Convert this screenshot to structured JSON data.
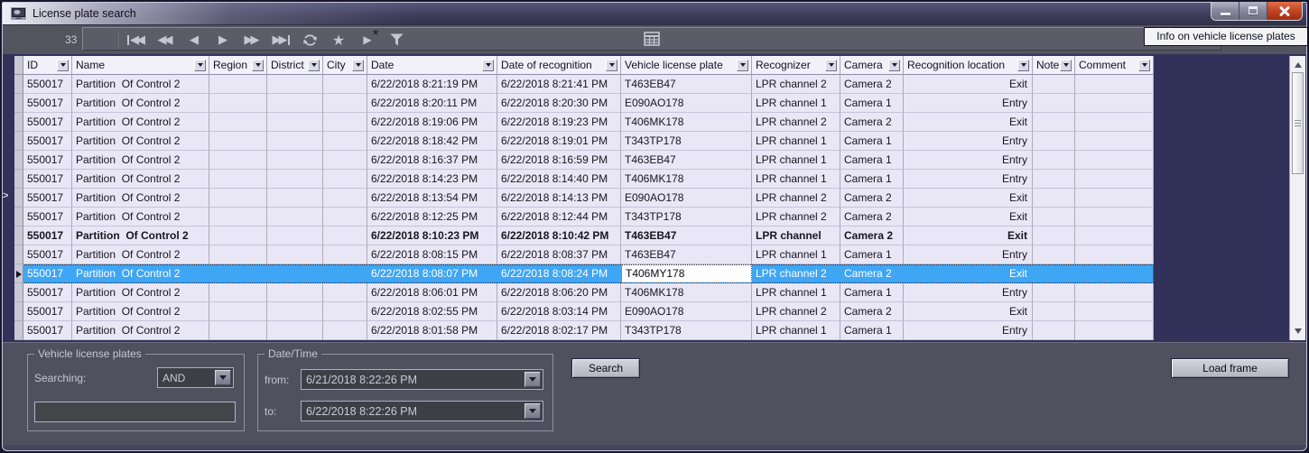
{
  "window": {
    "title": "License plate search"
  },
  "toolbar": {
    "record_count": "33",
    "nav_glyphs": {
      "first": "◀◀",
      "rewind": "◀◀",
      "previous": "◀",
      "next": "▶",
      "forward": "▶▶",
      "last": "▶▶",
      "star": "★",
      "go_to_star": "▶",
      "go_to_star_badge": "★"
    }
  },
  "info_button_label": "Info on vehicle license plates",
  "icons": {
    "app-icon": "framed picture",
    "grid-view-icon": "table grid",
    "refresh-icon": "circular arrows",
    "star-icon": "star",
    "go-to-star-icon": "play triangle with star",
    "filter-icon": "funnel",
    "minimize-icon": "bar",
    "maximize-icon": "box",
    "close-icon": "x cross",
    "filter-dropdown-icon": "down triangle",
    "scroll-arrows": "up/down triangles",
    "collapse-arrow": ">"
  },
  "table": {
    "columns": [
      {
        "key": "id",
        "label": "ID",
        "width": 54
      },
      {
        "key": "name",
        "label": "Name",
        "width": 152
      },
      {
        "key": "region",
        "label": "Region",
        "width": 64
      },
      {
        "key": "district",
        "label": "District",
        "width": 62
      },
      {
        "key": "city",
        "label": "City",
        "width": 49
      },
      {
        "key": "date",
        "label": "Date",
        "width": 144
      },
      {
        "key": "date_of_recognition",
        "label": "Date of recognition",
        "width": 137
      },
      {
        "key": "plate",
        "label": "Vehicle license plate",
        "width": 145
      },
      {
        "key": "recognizer",
        "label": "Recognizer",
        "width": 98
      },
      {
        "key": "camera",
        "label": "Camera",
        "width": 70
      },
      {
        "key": "location",
        "label": "Recognition location",
        "width": 143,
        "align": "right"
      },
      {
        "key": "note",
        "label": "Note",
        "width": 47
      },
      {
        "key": "comment",
        "label": "Comment",
        "width": 87
      }
    ],
    "rows": [
      {
        "id": "550017",
        "name": "Partition  Of Control 2",
        "region": "",
        "district": "",
        "city": "",
        "date": "6/22/2018 8:21:19 PM",
        "date_of_recognition": "6/22/2018 8:21:41 PM",
        "plate": "T463EB47",
        "recognizer": "LPR channel 2",
        "camera": "Camera 2",
        "location": "Exit",
        "note": "",
        "comment": ""
      },
      {
        "id": "550017",
        "name": "Partition  Of Control 2",
        "region": "",
        "district": "",
        "city": "",
        "date": "6/22/2018 8:20:11 PM",
        "date_of_recognition": "6/22/2018 8:20:30 PM",
        "plate": "E090AO178",
        "recognizer": "LPR channel 1",
        "camera": "Camera 1",
        "location": "Entry",
        "note": "",
        "comment": ""
      },
      {
        "id": "550017",
        "name": "Partition  Of Control 2",
        "region": "",
        "district": "",
        "city": "",
        "date": "6/22/2018 8:19:06 PM",
        "date_of_recognition": "6/22/2018 8:19:23 PM",
        "plate": "T406MK178",
        "recognizer": "LPR channel 2",
        "camera": "Camera 2",
        "location": "Exit",
        "note": "",
        "comment": ""
      },
      {
        "id": "550017",
        "name": "Partition  Of Control 2",
        "region": "",
        "district": "",
        "city": "",
        "date": "6/22/2018 8:18:42 PM",
        "date_of_recognition": "6/22/2018 8:19:01 PM",
        "plate": "T343TP178",
        "recognizer": "LPR channel 1",
        "camera": "Camera 1",
        "location": "Entry",
        "note": "",
        "comment": ""
      },
      {
        "id": "550017",
        "name": "Partition  Of Control 2",
        "region": "",
        "district": "",
        "city": "",
        "date": "6/22/2018 8:16:37 PM",
        "date_of_recognition": "6/22/2018 8:16:59 PM",
        "plate": "T463EB47",
        "recognizer": "LPR channel 1",
        "camera": "Camera 1",
        "location": "Entry",
        "note": "",
        "comment": ""
      },
      {
        "id": "550017",
        "name": "Partition  Of Control 2",
        "region": "",
        "district": "",
        "city": "",
        "date": "6/22/2018 8:14:23 PM",
        "date_of_recognition": "6/22/2018 8:14:40 PM",
        "plate": "T406MK178",
        "recognizer": "LPR channel 1",
        "camera": "Camera 1",
        "location": "Entry",
        "note": "",
        "comment": ""
      },
      {
        "id": "550017",
        "name": "Partition  Of Control 2",
        "region": "",
        "district": "",
        "city": "",
        "date": "6/22/2018 8:13:54 PM",
        "date_of_recognition": "6/22/2018 8:14:13 PM",
        "plate": "E090AO178",
        "recognizer": "LPR channel 2",
        "camera": "Camera 2",
        "location": "Exit",
        "note": "",
        "comment": ""
      },
      {
        "id": "550017",
        "name": "Partition  Of Control 2",
        "region": "",
        "district": "",
        "city": "",
        "date": "6/22/2018 8:12:25 PM",
        "date_of_recognition": "6/22/2018 8:12:44 PM",
        "plate": "T343TP178",
        "recognizer": "LPR channel 2",
        "camera": "Camera 2",
        "location": "Exit",
        "note": "",
        "comment": ""
      },
      {
        "id": "550017",
        "name": "Partition  Of Control 2",
        "region": "",
        "district": "",
        "city": "",
        "date": "6/22/2018 8:10:23 PM",
        "date_of_recognition": "6/22/2018 8:10:42 PM",
        "plate": "T463EB47",
        "recognizer": "LPR channel",
        "camera": "Camera 2",
        "location": "Exit",
        "note": "",
        "comment": "",
        "style": "bold"
      },
      {
        "id": "550017",
        "name": "Partition  Of Control 2",
        "region": "",
        "district": "",
        "city": "",
        "date": "6/22/2018 8:08:15 PM",
        "date_of_recognition": "6/22/2018 8:08:37 PM",
        "plate": "T463EB47",
        "recognizer": "LPR channel 1",
        "camera": "Camera 1",
        "location": "Entry",
        "note": "",
        "comment": ""
      },
      {
        "id": "550017",
        "name": "Partition  Of Control 2",
        "region": "",
        "district": "",
        "city": "",
        "date": "6/22/2018 8:08:07 PM",
        "date_of_recognition": "6/22/2018 8:08:24 PM",
        "plate": "T406MY178",
        "recognizer": "LPR channel 2",
        "camera": "Camera 2",
        "location": "Exit",
        "note": "",
        "comment": "",
        "style": "selected"
      },
      {
        "id": "550017",
        "name": "Partition  Of Control 2",
        "region": "",
        "district": "",
        "city": "",
        "date": "6/22/2018 8:06:01 PM",
        "date_of_recognition": "6/22/2018 8:06:20 PM",
        "plate": "T406MK178",
        "recognizer": "LPR channel 1",
        "camera": "Camera 1",
        "location": "Entry",
        "note": "",
        "comment": ""
      },
      {
        "id": "550017",
        "name": "Partition  Of Control 2",
        "region": "",
        "district": "",
        "city": "",
        "date": "6/22/2018 8:02:55 PM",
        "date_of_recognition": "6/22/2018 8:03:14 PM",
        "plate": "E090AO178",
        "recognizer": "LPR channel 2",
        "camera": "Camera 2",
        "location": "Exit",
        "note": "",
        "comment": ""
      },
      {
        "id": "550017",
        "name": "Partition  Of Control 2",
        "region": "",
        "district": "",
        "city": "",
        "date": "6/22/2018 8:01:58 PM",
        "date_of_recognition": "6/22/2018 8:02:17 PM",
        "plate": "T343TP178",
        "recognizer": "LPR channel 1",
        "camera": "Camera 1",
        "location": "Entry",
        "note": "",
        "comment": ""
      }
    ]
  },
  "search_panel": {
    "plates_group": {
      "title": "Vehicle license plates",
      "searching_label": "Searching:",
      "operator_value": "AND",
      "plate_input_value": ""
    },
    "datetime_group": {
      "title": "Date/Time",
      "from_label": "from:",
      "from_value": "6/21/2018 8:22:26 PM",
      "to_label": "to:",
      "to_value": "6/22/2018 8:22:26 PM"
    },
    "search_button": "Search",
    "load_frame_button": "Load frame"
  },
  "colors": {
    "selection_blue": "#3EA6F5",
    "row_background": "#E9E6F6",
    "table_void_navy": "#31315A",
    "panel_gray": "#50505E",
    "toolbar_gray": "#54545E",
    "close_button_red": "#C24424"
  }
}
